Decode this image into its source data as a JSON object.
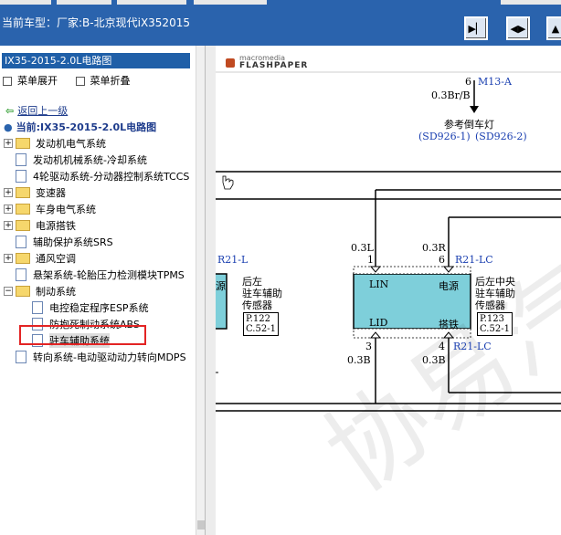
{
  "window": {
    "title": "当前车型：厂家:B-北京现代iX352015",
    "toolbar_buttons": [
      "fit-page-icon",
      "fit-width-icon",
      "fit-height-icon"
    ]
  },
  "sidebar": {
    "header": "IX35-2015-2.0L电路图",
    "menu": {
      "expand": "菜单展开",
      "collapse": "菜单折叠"
    },
    "back_link": "返回上一级",
    "current": "当前:IX35-2015-2.0L电路图",
    "items": [
      {
        "label": "发动机电气系统",
        "type": "folder",
        "expandable": true,
        "selected": false
      },
      {
        "label": "发动机机械系统-冷却系统",
        "type": "doc",
        "expandable": false,
        "selected": false
      },
      {
        "label": "4轮驱动系统-分动器控制系统TCCS",
        "type": "doc",
        "expandable": false,
        "selected": false
      },
      {
        "label": "变速器",
        "type": "folder",
        "expandable": true,
        "selected": false
      },
      {
        "label": "车身电气系统",
        "type": "folder",
        "expandable": true,
        "selected": false
      },
      {
        "label": "电源搭铁",
        "type": "folder",
        "expandable": true,
        "selected": false
      },
      {
        "label": "辅助保护系统SRS",
        "type": "doc",
        "expandable": false,
        "selected": false
      },
      {
        "label": "通风空调",
        "type": "folder",
        "expandable": true,
        "selected": false
      },
      {
        "label": "悬架系统-轮胎压力检测模块TPMS",
        "type": "doc",
        "expandable": false,
        "selected": false
      },
      {
        "label": "制动系统",
        "type": "folder",
        "expandable": true,
        "selected": false
      },
      {
        "label": "电控稳定程序ESP系统",
        "type": "doc",
        "expandable": false,
        "selected": false
      },
      {
        "label": "防抱死制动系统ABS",
        "type": "doc",
        "expandable": false,
        "selected": false
      },
      {
        "label": "驻车辅助系统",
        "type": "doc",
        "expandable": false,
        "selected": true
      },
      {
        "label": "转向系统-电动驱动动力转向MDPS",
        "type": "doc",
        "expandable": false,
        "selected": false
      }
    ]
  },
  "viewer": {
    "logo_top": "macromedia",
    "logo_bottom": "FLASHPAPER",
    "diagram": {
      "top_pin": "6",
      "top_conn": "M13-A",
      "top_wire": "0.3Br/B",
      "ref_label": "参考倒车灯",
      "ref_codes": [
        "(SD926-1)",
        "(SD926-2)"
      ],
      "left_conn": "R21-L",
      "left_box_text": "源",
      "left_sensor": [
        "后左",
        "驻车辅助",
        "传感器"
      ],
      "left_ref": [
        "P.122",
        "C.52-1"
      ],
      "center_wire_l": "0.3L",
      "center_pin_l": "1",
      "center_wire_r": "0.3R",
      "center_pin_r": "6",
      "center_conn_top": "R21-LC",
      "center_box": {
        "lin": "LIN",
        "power": "电源",
        "lid": "LID",
        "ground": "搭铁"
      },
      "center_sensor": [
        "后左中央",
        "驻车辅助",
        "传感器"
      ],
      "center_ref": [
        "P.123",
        "C.52-1"
      ],
      "bottom_pin_l": "3",
      "bottom_pin_r": "4",
      "bottom_conn": "R21-LC",
      "bottom_wire_l": "0.3B",
      "bottom_wire_r": "0.3B"
    },
    "watermark": "协易汽车"
  }
}
